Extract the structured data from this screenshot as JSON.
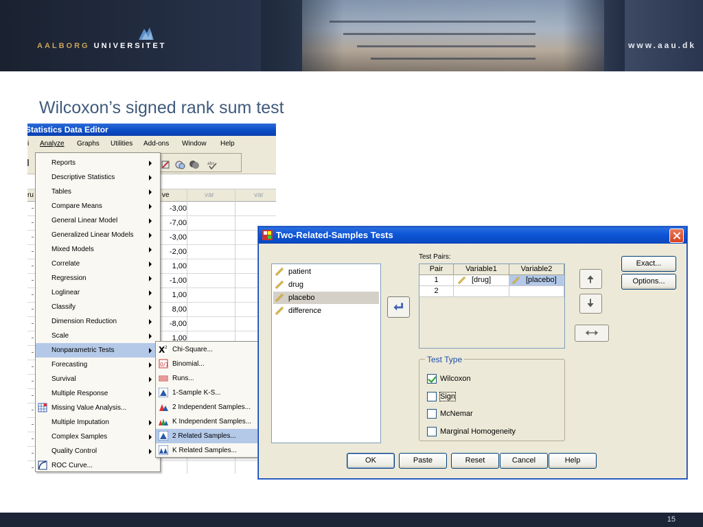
{
  "slide": {
    "logo_word1": "AALBORG",
    "logo_word2": "UNIVERSITET",
    "url": "www.aau.dk",
    "title": "Wilcoxon’s signed rank sum test",
    "page_number": "15"
  },
  "data_editor": {
    "title": "Statistics Data Editor",
    "menu": [
      "Analyze",
      "Graphs",
      "Utilities",
      "Add-ons",
      "Window",
      "Help"
    ],
    "column_headers": [
      "ve",
      "var",
      "var"
    ],
    "row_values": [
      "-3,00",
      "-7,00",
      "-3,00",
      "-2,00",
      "1,00",
      "-1,00",
      "1,00",
      "8,00",
      "-8,00",
      "1,00"
    ]
  },
  "analyze_menu": {
    "items": [
      {
        "label": "Reports",
        "submenu": true
      },
      {
        "label": "Descriptive Statistics",
        "submenu": true
      },
      {
        "label": "Tables",
        "submenu": true
      },
      {
        "label": "Compare Means",
        "submenu": true
      },
      {
        "label": "General Linear Model",
        "submenu": true
      },
      {
        "label": "Generalized Linear Models",
        "submenu": true
      },
      {
        "label": "Mixed Models",
        "submenu": true
      },
      {
        "label": "Correlate",
        "submenu": true
      },
      {
        "label": "Regression",
        "submenu": true
      },
      {
        "label": "Loglinear",
        "submenu": true
      },
      {
        "label": "Classify",
        "submenu": true
      },
      {
        "label": "Dimension Reduction",
        "submenu": true
      },
      {
        "label": "Scale",
        "submenu": true
      },
      {
        "label": "Nonparametric Tests",
        "submenu": true,
        "highlighted": true
      },
      {
        "label": "Forecasting",
        "submenu": true
      },
      {
        "label": "Survival",
        "submenu": true
      },
      {
        "label": "Multiple Response",
        "submenu": true
      },
      {
        "label": "Missing Value Analysis...",
        "submenu": false,
        "icon": "missing-value-icon"
      },
      {
        "label": "Multiple Imputation",
        "submenu": true
      },
      {
        "label": "Complex Samples",
        "submenu": true
      },
      {
        "label": "Quality Control",
        "submenu": true
      },
      {
        "label": "ROC Curve...",
        "submenu": false,
        "icon": "roc-curve-icon"
      }
    ]
  },
  "nonparametric_menu": {
    "items": [
      {
        "label": "Chi-Square...",
        "icon": "chi-square-icon"
      },
      {
        "label": "Binomial...",
        "icon": "binomial-icon"
      },
      {
        "label": "Runs...",
        "icon": "runs-icon"
      },
      {
        "label": "1-Sample K-S...",
        "icon": "one-sample-ks-icon"
      },
      {
        "label": "2 Independent Samples...",
        "icon": "two-independent-icon"
      },
      {
        "label": "K Independent Samples...",
        "icon": "k-independent-icon"
      },
      {
        "label": "2 Related Samples...",
        "icon": "two-related-icon",
        "highlighted": true
      },
      {
        "label": "K Related Samples...",
        "icon": "k-related-icon"
      }
    ]
  },
  "dialog": {
    "title": "Two-Related-Samples Tests",
    "variables": [
      "patient",
      "drug",
      "placebo",
      "difference"
    ],
    "selected_variable": "placebo",
    "test_pairs_label": "Test Pairs:",
    "pairs_headers": [
      "Pair",
      "Variable1",
      "Variable2"
    ],
    "pairs": [
      {
        "pair": "1",
        "variable1": "[drug]",
        "variable2": "[placebo]"
      },
      {
        "pair": "2",
        "variable1": "",
        "variable2": ""
      }
    ],
    "exact_label": "Exact...",
    "options_label": "Options...",
    "test_type_label": "Test Type",
    "tests": [
      {
        "label": "Wilcoxon",
        "checked": true
      },
      {
        "label": "Sign",
        "checked": false
      },
      {
        "label": "McNemar",
        "checked": false
      },
      {
        "label": "Marginal Homogeneity",
        "checked": false
      }
    ],
    "buttons": {
      "ok": "OK",
      "paste": "Paste",
      "reset": "Reset",
      "cancel": "Cancel",
      "help": "Help"
    }
  },
  "colors": {
    "accent_blue": "#0a47bd",
    "title_blue": "#3f5a7c",
    "highlight": "#b4c9e8"
  }
}
